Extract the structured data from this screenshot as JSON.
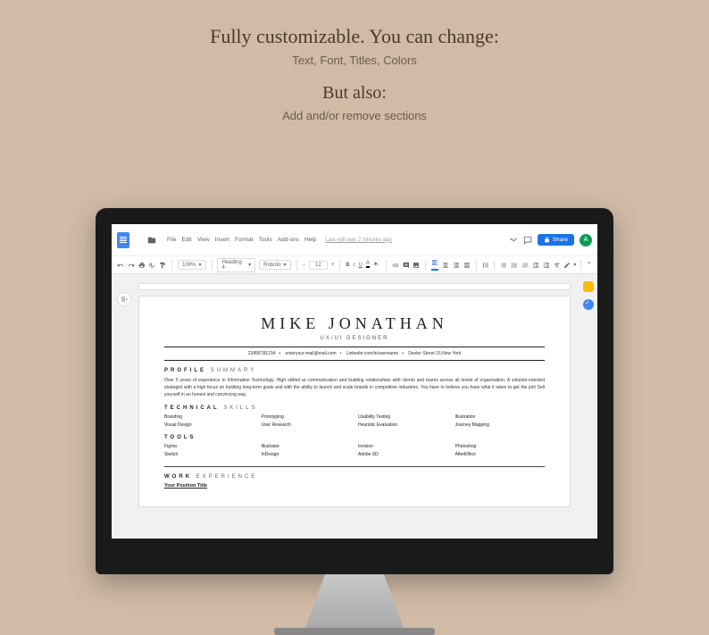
{
  "promo": {
    "line1": "Fully customizable. You can change:",
    "line2": "Text, Font, Titles, Colors",
    "line3": "But also:",
    "line4": "Add and/or remove sections"
  },
  "docs": {
    "menus": [
      "File",
      "Edit",
      "View",
      "Insert",
      "Format",
      "Tools",
      "Add-ons",
      "Help"
    ],
    "last_edit": "Last edit was 2 minutes ago",
    "share": "Share",
    "avatar_letter": "A",
    "toolbar": {
      "zoom": "100%",
      "style": "Heading 4",
      "font": "Roboto",
      "size": "12"
    }
  },
  "resume": {
    "name": "MIKE JONATHAN",
    "role": "UX/UI DESIGNER",
    "contact": {
      "phone": "23456781234",
      "email": "enteryour-mail@mail.com",
      "linkedin": "Linkedin.com/in/username",
      "address": "Dexter Street 15,New York"
    },
    "summary_title_bold": "PROFILE",
    "summary_title_light": "SUMMARY",
    "summary": "Over 5 years of experience in Information Technology. High skilled at communication and building relationships with clients and teams across all levels of organisation. A solution-oriented strategist with a high focus on building long-term goals and with the ability to launch and scale brands in competitive industries. You have to believe you have what it takes to get the job! Sell yourself in an honest and convincing way.",
    "skills_title_bold": "TECHNICAL",
    "skills_title_light": "SKILLS",
    "skills": [
      "Branding",
      "Prototyping",
      "Usability Testing",
      "Illustration",
      "Visual Design",
      "User Research",
      "Heuristic Evaluation",
      "Journey Mapping"
    ],
    "tools_title": "TOOLS",
    "tools": [
      "Figma",
      "Illustrator",
      "Invision",
      "Photoshop",
      "Sketch",
      "InDesign",
      "Adobe XD",
      "AfterEffect"
    ],
    "work_title_bold": "WORK",
    "work_title_light": "EXPERIENCE",
    "position": "Your Position Title"
  }
}
